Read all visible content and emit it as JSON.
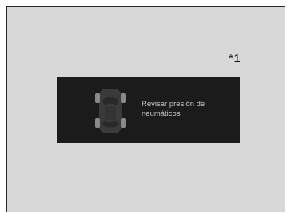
{
  "footnote": "*1",
  "display": {
    "message": "Revisar presión de\nneumáticos",
    "icon": "car-tire-pressure-icon"
  },
  "colors": {
    "page_background": "#d8d8d8",
    "screen_background": "#1b1b1b",
    "text": "#c8c8c8"
  }
}
